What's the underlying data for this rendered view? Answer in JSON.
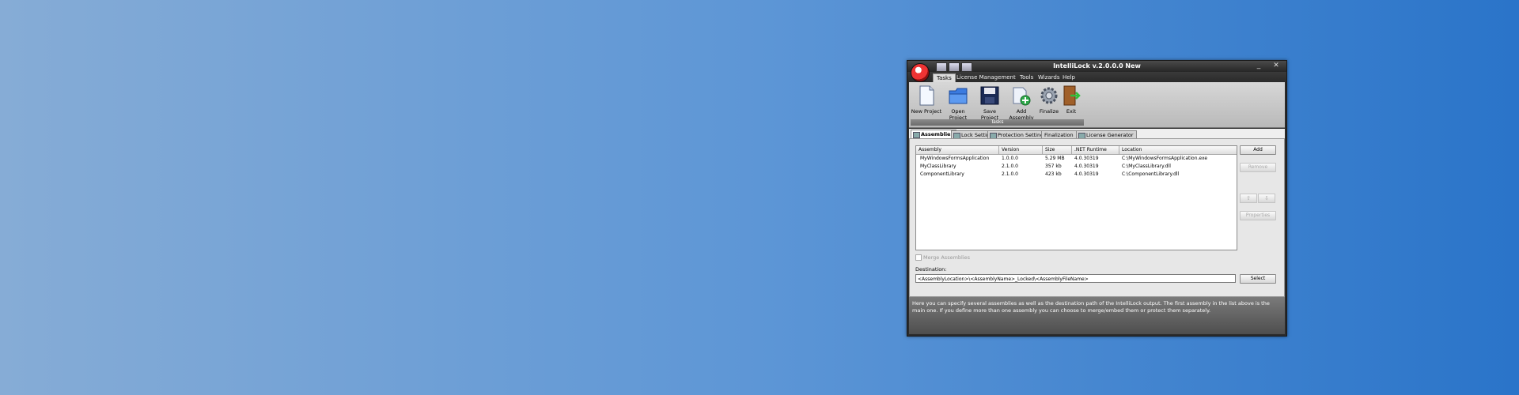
{
  "window": {
    "title": "IntelliLock v.2.0.0.0 New",
    "minimize": "_",
    "close": "✕"
  },
  "menu": [
    "Tasks",
    "License Management",
    "Tools",
    "Wizards",
    "Help"
  ],
  "ribbon": {
    "group_label": "Tasks",
    "buttons": [
      "New Project",
      "Open Project",
      "Save Project",
      "Add Assembly",
      "Finalize",
      "Exit"
    ]
  },
  "doc_tabs": [
    "Assemblies",
    "Lock Settings",
    "Protection Settings",
    "Finalization",
    "License Generator"
  ],
  "assemblies": {
    "columns": [
      "Assembly",
      "Version",
      "Size",
      ".NET Runtime",
      "Location"
    ],
    "rows": [
      [
        "MyWindowsFormsApplication",
        "1.0.0.0",
        "5.29 MB",
        "4.0.30319",
        "C:\\MyWindowsFormsApplication.exe"
      ],
      [
        "MyClassLibrary",
        "2.1.0.0",
        "357 kb",
        "4.0.30319",
        "C:\\MyClassLibrary.dll"
      ],
      [
        "ComponentLibrary",
        "2.1.0.0",
        "423 kb",
        "4.0.30319",
        "C:\\ComponentLibrary.dll"
      ]
    ]
  },
  "side_buttons": {
    "add": "Add",
    "remove": "Remove",
    "up": "⇧",
    "down": "⇩",
    "properties": "Properties"
  },
  "merge_label": "Merge Assemblies",
  "destination": {
    "label": "Destination:",
    "value": "<AssemblyLocation>\\<AssemblyName>_Locked\\<AssemblyFileName>",
    "select": "Select"
  },
  "info_text": "Here you can specify several assemblies as well as the destination path of the IntelliLock output. The first assembly in the list above is the main one. If you define more than one assembly you can choose to merge/embed them or protect them separately.",
  "colors": {
    "desktop_left": "#86acd6",
    "desktop_right": "#2a74c9",
    "window_frame": "#2b2b2b"
  }
}
